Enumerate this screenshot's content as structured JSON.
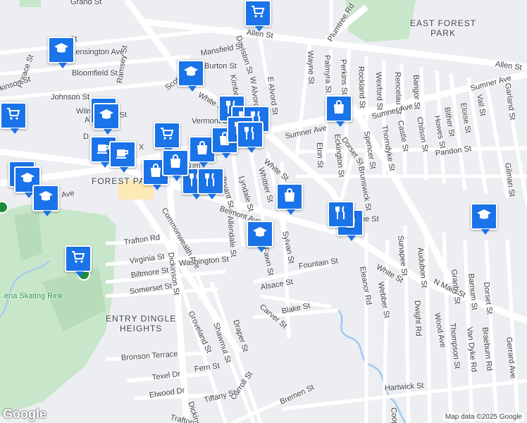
{
  "map": {
    "areas": [
      {
        "id": "east-forest-park",
        "text": "EAST FOREST\nPARK"
      },
      {
        "id": "forest-park",
        "text": "FOREST PARK"
      },
      {
        "id": "entry-dingle-heights",
        "text": "ENTRY DINGLE\nHEIGHTS"
      }
    ],
    "streets": [
      {
        "id": "grand-st",
        "text": "Grand St"
      },
      {
        "id": "allen-st-top",
        "text": "Allen St"
      },
      {
        "id": "plumtree-rd",
        "text": "Plumtree Rd"
      },
      {
        "id": "allen-st-right",
        "text": "Allen St"
      },
      {
        "id": "kensington-ave",
        "text": "Kensington Ave"
      },
      {
        "id": "bloomfield-st",
        "text": "Bloomfield St"
      },
      {
        "id": "johnson-st",
        "text": "Johnson St"
      },
      {
        "id": "ramsey-st",
        "text": "Ramsey St"
      },
      {
        "id": "horace-st",
        "text": "Horace St"
      },
      {
        "id": "daviston-st",
        "text": "Daviston St"
      },
      {
        "id": "mansfield-st",
        "text": "Mansfield St"
      },
      {
        "id": "kimberly-st",
        "text": "Kimberly St"
      },
      {
        "id": "w-alvord-st",
        "text": "W Alvord St"
      },
      {
        "id": "e-alvord-st",
        "text": "E Alvord St"
      },
      {
        "id": "wayne-st",
        "text": "Wayne St"
      },
      {
        "id": "palmyra-st",
        "text": "Palmyra St"
      },
      {
        "id": "perkins-st",
        "text": "Perkins St"
      },
      {
        "id": "rockland-st",
        "text": "Rockland St"
      },
      {
        "id": "wexford-st",
        "text": "Wexford St"
      },
      {
        "id": "rencelau-st",
        "text": "Rencelau St"
      },
      {
        "id": "bangor-st",
        "text": "Bangor St"
      },
      {
        "id": "sumner-ave-right",
        "text": "Sumner Ave"
      },
      {
        "id": "sumner-ave-mid",
        "text": "Sumner Ave"
      },
      {
        "id": "sumner-ave-left",
        "text": "Sumner Ave"
      },
      {
        "id": "vermont-st",
        "text": "Vermont St"
      },
      {
        "id": "white-st-top",
        "text": "White St"
      },
      {
        "id": "white-st-mid",
        "text": "White St"
      },
      {
        "id": "white-st-low",
        "text": "White St"
      },
      {
        "id": "eton-st",
        "text": "Eton St"
      },
      {
        "id": "eckington-st",
        "text": "Eckington St"
      },
      {
        "id": "dorset-st",
        "text": "Dorset St"
      },
      {
        "id": "spencer-st",
        "text": "Spencer St"
      },
      {
        "id": "thorndyke-st",
        "text": "Thorndyke St"
      },
      {
        "id": "castle-st",
        "text": "Castle St"
      },
      {
        "id": "chilson-st",
        "text": "Chilson St"
      },
      {
        "id": "howes-st",
        "text": "Howes St"
      },
      {
        "id": "bither-st",
        "text": "Bither St"
      },
      {
        "id": "eloise-st",
        "text": "Eloise St"
      },
      {
        "id": "vail-st",
        "text": "Vail St"
      },
      {
        "id": "garland-st",
        "text": "Garland St"
      },
      {
        "id": "paridon-st",
        "text": "Paridon St"
      },
      {
        "id": "gilman-st",
        "text": "Gilman St"
      },
      {
        "id": "brunswick-st",
        "text": "Brunswick St"
      },
      {
        "id": "wilmont-st",
        "text": "Wilmont St"
      },
      {
        "id": "alderman-st",
        "text": "Alderman St"
      },
      {
        "id": "scott-st",
        "text": "Scott St"
      },
      {
        "id": "burton-st",
        "text": "Burton St"
      },
      {
        "id": "bryant-st",
        "text": "Bryant St"
      },
      {
        "id": "lyndale-st",
        "text": "Lyndale St"
      },
      {
        "id": "whittier-st",
        "text": "Whittier St"
      },
      {
        "id": "belmont-ave",
        "text": "Belmont Ave"
      },
      {
        "id": "commonwealth-ave",
        "text": "Commonwealth Ave"
      },
      {
        "id": "trafton-rd",
        "text": "Trafton Rd"
      },
      {
        "id": "virginia-st",
        "text": "Virginia St"
      },
      {
        "id": "biltmore-st",
        "text": "Biltmore St"
      },
      {
        "id": "somerset-st",
        "text": "Somerset St"
      },
      {
        "id": "washington-st",
        "text": "Washington St"
      },
      {
        "id": "dickinson-st",
        "text": "Dickinson St"
      },
      {
        "id": "allendale-st",
        "text": "Allendale St"
      },
      {
        "id": "fawn-st",
        "text": "Fawn St"
      },
      {
        "id": "sylvan-st",
        "text": "Sylvan St"
      },
      {
        "id": "fountain-st",
        "text": "Fountain St"
      },
      {
        "id": "alsace-st",
        "text": "Alsace St"
      },
      {
        "id": "carver-st",
        "text": "Carver St"
      },
      {
        "id": "blake-st",
        "text": "Blake St"
      },
      {
        "id": "eleanor-rd",
        "text": "Eleanor Rd"
      },
      {
        "id": "webber-st",
        "text": "Webber St"
      },
      {
        "id": "sunapee-st",
        "text": "Sunapee St"
      },
      {
        "id": "audubon-st",
        "text": "Audubon St"
      },
      {
        "id": "dwight-rd",
        "text": "Dwight Rd"
      },
      {
        "id": "n-main-st",
        "text": "N Main St"
      },
      {
        "id": "wood-ave",
        "text": "Wood Ave"
      },
      {
        "id": "granby-st",
        "text": "Granby St"
      },
      {
        "id": "barnum-st",
        "text": "Barnum St"
      },
      {
        "id": "dorset-st-right",
        "text": "Dorset St"
      },
      {
        "id": "thompson-st",
        "text": "Thompson St"
      },
      {
        "id": "van-dyke-rd",
        "text": "Van Dyke Rd"
      },
      {
        "id": "braeburn-rd",
        "text": "Braeburn Rd"
      },
      {
        "id": "gerrard-ave",
        "text": "Gerrard Ave"
      },
      {
        "id": "draper-st",
        "text": "Draper St"
      },
      {
        "id": "shawmut-st",
        "text": "Shawmut St"
      },
      {
        "id": "groveland-st",
        "text": "Groveland St"
      },
      {
        "id": "bronson-terrace",
        "text": "Bronson Terrace"
      },
      {
        "id": "fern-st",
        "text": "Fern St"
      },
      {
        "id": "texel-dr",
        "text": "Texel Dr"
      },
      {
        "id": "elwood-dr",
        "text": "Elwood Dr"
      },
      {
        "id": "carroll-st",
        "text": "Carroll St"
      },
      {
        "id": "tiffany-st",
        "text": "Tiffany St"
      },
      {
        "id": "bremen-st",
        "text": "Bremen St"
      },
      {
        "id": "hartwick-st",
        "text": "Hartwick St"
      },
      {
        "id": "cooper-st",
        "text": "Cooper St"
      },
      {
        "id": "dickinson-st-low",
        "text": "Dickinson St"
      },
      {
        "id": "trafton-low",
        "text": "Trafton"
      },
      {
        "id": "sumner-ave-far-left",
        "text": "mner Ave"
      },
      {
        "id": "ridge-st",
        "text": "ge St"
      },
      {
        "id": "dickinson-st-left",
        "text": "kinson St"
      },
      {
        "id": "d-left",
        "text": "D"
      },
      {
        "id": "x-label",
        "text": "X"
      },
      {
        "id": "sumner-cut",
        "text": "Sum"
      },
      {
        "id": "ne-st",
        "text": "ne St"
      }
    ],
    "places": [
      {
        "id": "skating-rink",
        "text": "ena Skating Rink"
      }
    ],
    "pois": [
      {
        "type": "grocery-icon"
      },
      {
        "type": "school-icon"
      },
      {
        "type": "school-icon"
      },
      {
        "type": "grocery-icon"
      },
      {
        "type": "school-icon"
      },
      {
        "type": "grocery-icon"
      },
      {
        "type": "school-icon"
      },
      {
        "type": "cafe-icon"
      },
      {
        "type": "grocery-icon"
      },
      {
        "type": "cafe-icon"
      },
      {
        "type": "shopping-bag-icon"
      },
      {
        "type": "shopping-bag-icon"
      },
      {
        "type": "restaurant-icon"
      },
      {
        "type": "restaurant-icon"
      },
      {
        "type": "restaurant-icon"
      },
      {
        "type": "shopping-bag-icon"
      },
      {
        "type": "restaurant-icon"
      },
      {
        "type": "restaurant-icon"
      },
      {
        "type": "school-icon"
      },
      {
        "type": "shopping-bag-icon"
      },
      {
        "type": "shopping-bag-icon"
      },
      {
        "type": "restaurant-icon"
      },
      {
        "type": "shopping-bag-icon"
      },
      {
        "type": "school-icon"
      },
      {
        "type": "grocery-icon"
      },
      {
        "type": "school-icon"
      },
      {
        "type": "school-icon"
      },
      {
        "type": "shopping-bag-icon"
      },
      {
        "type": "restaurant-icon"
      },
      {
        "type": "restaurant-icon"
      }
    ],
    "attribution": "Map data ©2025 Google",
    "logo": "Google",
    "colors": {
      "poi": "#1a73e8",
      "park": "#c8e6c9",
      "water": "#9fc9f2",
      "road": "#ffffff",
      "background": "#eceef1"
    }
  }
}
